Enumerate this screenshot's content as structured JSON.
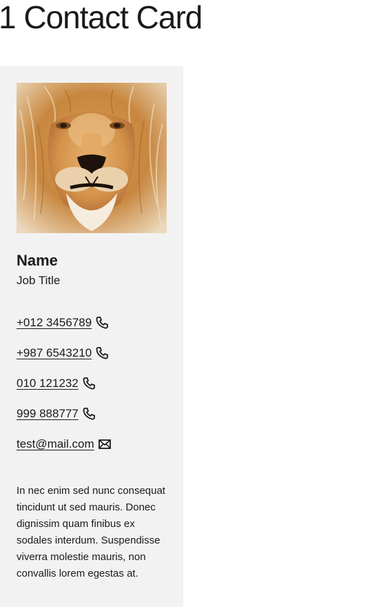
{
  "page": {
    "title": "1 Contact Card"
  },
  "card": {
    "name": "Name",
    "job_title": "Job Title",
    "contacts": [
      {
        "label": "+012 3456789",
        "icon": "phone-icon"
      },
      {
        "label": "+987 6543210",
        "icon": "phone-icon"
      },
      {
        "label": "010 121232",
        "icon": "phone-icon"
      },
      {
        "label": "999 888777",
        "icon": "phone-icon"
      },
      {
        "label": "test@mail.com",
        "icon": "envelope-icon"
      }
    ],
    "bio": "In nec enim sed nunc consequat tincidunt ut sed mauris. Donec dignissim quam finibus ex sodales interdum. Suspendisse viverra molestie mauris, non convallis lorem egestas at.",
    "background_color": "#f2f2f2"
  }
}
